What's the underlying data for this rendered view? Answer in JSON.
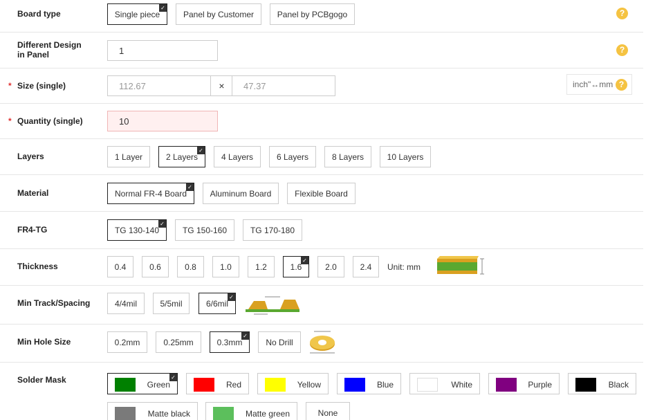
{
  "board_type": {
    "label": "Board type",
    "options": [
      "Single piece",
      "Panel by Customer",
      "Panel by PCBgogo"
    ],
    "selected": "Single piece"
  },
  "diff_design": {
    "label_line1": "Different Design",
    "label_line2": "in Panel",
    "value": "1"
  },
  "size": {
    "label": "Size (single)",
    "width": "112.67",
    "height": "47.37",
    "separator": "×",
    "unit_toggle": "inch\"↔mm"
  },
  "quantity": {
    "label": "Quantity (single)",
    "value": "10"
  },
  "layers": {
    "label": "Layers",
    "options": [
      "1 Layer",
      "2 Layers",
      "4 Layers",
      "6 Layers",
      "8 Layers",
      "10 Layers"
    ],
    "selected": "2 Layers"
  },
  "material": {
    "label": "Material",
    "options": [
      "Normal FR-4 Board",
      "Aluminum Board",
      "Flexible Board"
    ],
    "selected": "Normal FR-4 Board"
  },
  "fr4tg": {
    "label": "FR4-TG",
    "options": [
      "TG 130-140",
      "TG 150-160",
      "TG 170-180"
    ],
    "selected": "TG 130-140"
  },
  "thickness": {
    "label": "Thickness",
    "options": [
      "0.4",
      "0.6",
      "0.8",
      "1.0",
      "1.2",
      "1.6",
      "2.0",
      "2.4"
    ],
    "selected": "1.6",
    "unit": "Unit: mm"
  },
  "track": {
    "label": "Min Track/Spacing",
    "options": [
      "4/4mil",
      "5/5mil",
      "6/6mil"
    ],
    "selected": "6/6mil"
  },
  "hole": {
    "label": "Min Hole Size",
    "options": [
      "0.2mm",
      "0.25mm",
      "0.3mm",
      "No Drill"
    ],
    "selected": "0.3mm"
  },
  "solder_mask": {
    "label": "Solder Mask",
    "options": [
      {
        "name": "Green",
        "color": "#008000"
      },
      {
        "name": "Red",
        "color": "#ff0000"
      },
      {
        "name": "Yellow",
        "color": "#ffff00"
      },
      {
        "name": "Blue",
        "color": "#0000ff"
      },
      {
        "name": "White",
        "color": "#ffffff"
      },
      {
        "name": "Purple",
        "color": "#800080"
      },
      {
        "name": "Black",
        "color": "#000000"
      },
      {
        "name": "Matte black",
        "color": "#7a7a7a"
      },
      {
        "name": "Matte green",
        "color": "#5cbf5c"
      },
      {
        "name": "None",
        "color": ""
      }
    ],
    "selected": "Green"
  },
  "help_symbol": "?",
  "required_mark": "*"
}
